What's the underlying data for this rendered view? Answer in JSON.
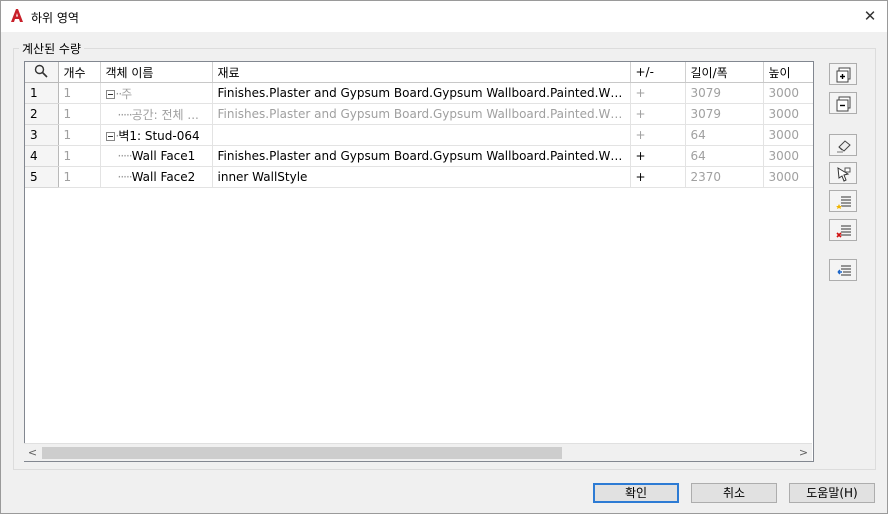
{
  "window": {
    "title": "하위 영역"
  },
  "group_label": "계산된 수량",
  "columns": [
    "개수",
    "객체 이름",
    "재료",
    "+/-",
    "길이/폭",
    "높이"
  ],
  "rows": [
    {
      "num": "1",
      "count": "1",
      "name": "주",
      "material": "Finishes.Plaster and Gypsum Board.Gypsum Wallboard.Painted.White",
      "pm": "+",
      "length": "3079",
      "height": "3000"
    },
    {
      "num": "2",
      "count": "1",
      "name": "공간: 전체 ...",
      "material": "Finishes.Plaster and Gypsum Board.Gypsum Wallboard.Painted.White",
      "pm": "+",
      "length": "3079",
      "height": "3000"
    },
    {
      "num": "3",
      "count": "1",
      "name": "벽1: Stud-064",
      "material": "",
      "pm": "+",
      "length": "64",
      "height": "3000"
    },
    {
      "num": "4",
      "count": "1",
      "name": "Wall Face1",
      "material": "Finishes.Plaster and Gypsum Board.Gypsum Wallboard.Painted.White",
      "pm": "+",
      "length": "64",
      "height": "3000"
    },
    {
      "num": "5",
      "count": "1",
      "name": "Wall Face2",
      "material": "inner WallStyle",
      "pm": "+",
      "length": "2370",
      "height": "3000"
    }
  ],
  "side_buttons": [
    "add-icon",
    "remove-icon",
    "select-eraser-icon",
    "pick-icon",
    "add-list-icon",
    "delete-list-icon",
    "import-list-icon"
  ],
  "buttons": {
    "ok": "확인",
    "cancel": "취소",
    "help": "도움말(H)"
  },
  "colors": {
    "app_icon": "#c8202a",
    "default_button_border": "#2d7bd4"
  }
}
